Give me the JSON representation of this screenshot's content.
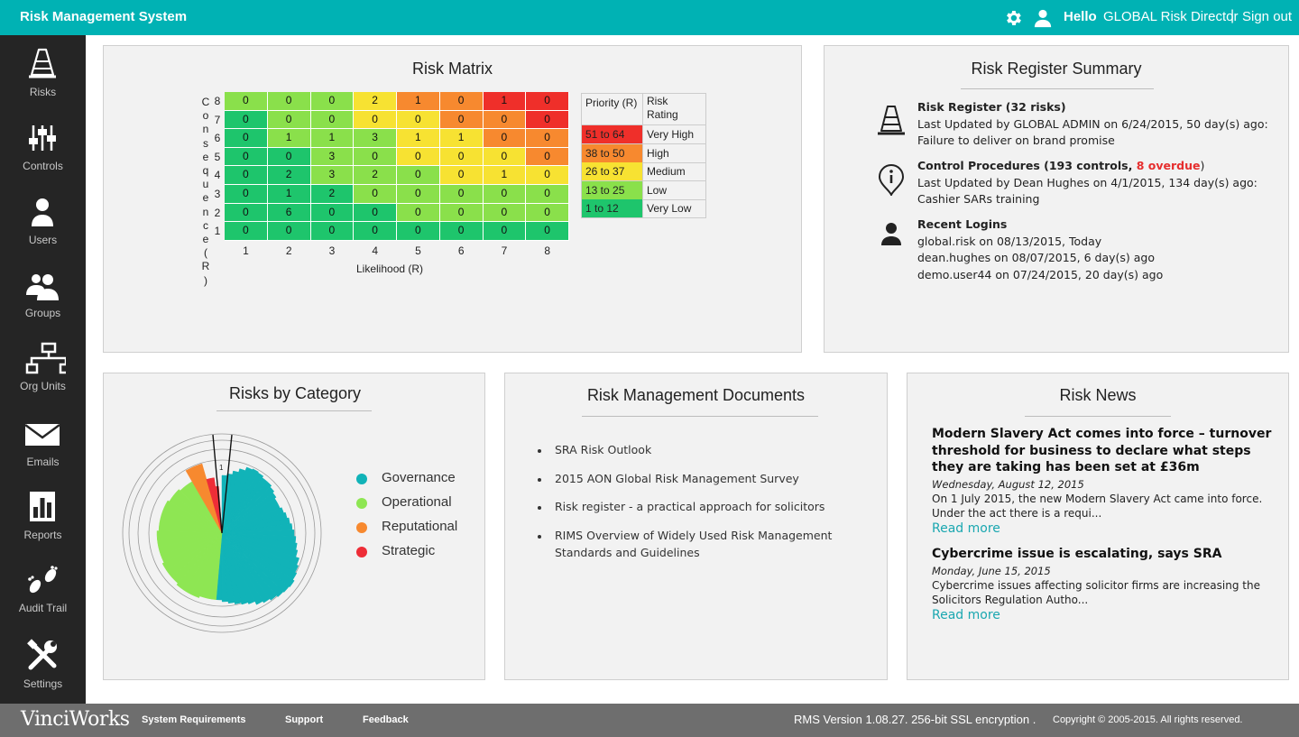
{
  "header": {
    "title": "Risk Management System",
    "hello": "Hello",
    "user_role": "GLOBAL Risk Director",
    "separator": "|",
    "sign_out": "Sign out",
    "icons": [
      "gear-icon",
      "user-icon"
    ]
  },
  "sidebar": {
    "items": [
      {
        "label": "Risks",
        "icon": "traffic-cone-icon"
      },
      {
        "label": "Controls",
        "icon": "sliders-icon"
      },
      {
        "label": "Users",
        "icon": "user-icon"
      },
      {
        "label": "Groups",
        "icon": "group-icon"
      },
      {
        "label": "Org Units",
        "icon": "org-chart-icon"
      },
      {
        "label": "Emails",
        "icon": "envelope-icon"
      },
      {
        "label": "Reports",
        "icon": "bar-chart-icon"
      },
      {
        "label": "Audit Trail",
        "icon": "footprints-icon"
      },
      {
        "label": "Settings",
        "icon": "tools-icon"
      }
    ]
  },
  "risk_matrix": {
    "title": "Risk Matrix",
    "y_axis_label": "Consequence(R)",
    "x_axis_label": "Likelihood (R)",
    "x_ticks": [
      "1",
      "2",
      "3",
      "4",
      "5",
      "6",
      "7",
      "8"
    ],
    "y_ticks": [
      "8",
      "7",
      "6",
      "5",
      "4",
      "3",
      "2",
      "1"
    ],
    "rows": [
      [
        "0",
        "0",
        "0",
        "2",
        "1",
        "0",
        "1",
        "0"
      ],
      [
        "0",
        "0",
        "0",
        "0",
        "0",
        "0",
        "0",
        "0"
      ],
      [
        "0",
        "1",
        "1",
        "3",
        "1",
        "1",
        "0",
        "0"
      ],
      [
        "0",
        "0",
        "3",
        "0",
        "0",
        "0",
        "0",
        "0"
      ],
      [
        "0",
        "2",
        "3",
        "2",
        "0",
        "0",
        "1",
        "0"
      ],
      [
        "0",
        "1",
        "2",
        "0",
        "0",
        "0",
        "0",
        "0"
      ],
      [
        "0",
        "6",
        "0",
        "0",
        "0",
        "0",
        "0",
        "0"
      ],
      [
        "0",
        "0",
        "0",
        "0",
        "0",
        "0",
        "0",
        "0"
      ]
    ],
    "legend": {
      "header_priority": "Priority (R)",
      "header_rating": "Risk Rating",
      "rows": [
        {
          "range": "51 to 64",
          "rating": "Very High",
          "color": "#ef2f2a"
        },
        {
          "range": "38 to 50",
          "rating": "High",
          "color": "#f7892f"
        },
        {
          "range": "26 to 37",
          "rating": "Medium",
          "color": "#f7e232"
        },
        {
          "range": "13 to 25",
          "rating": "Low",
          "color": "#8ae04b"
        },
        {
          "range": "1 to 12",
          "rating": "Very Low",
          "color": "#1ec56c"
        }
      ]
    }
  },
  "risk_register": {
    "title": "Risk Register Summary",
    "register": {
      "heading": "Risk Register (32 risks)",
      "line1": "Last Updated by GLOBAL ADMIN on 6/24/2015, 50 day(s) ago:",
      "line2": "Failure to deliver on brand promise"
    },
    "controls": {
      "heading": "Control Procedures (193 controls, ",
      "overdue": "8 overdue",
      "heading_end": ")",
      "line1": "Last Updated by Dean Hughes on 4/1/2015, 134 day(s) ago:",
      "line2": "Cashier SARs training"
    },
    "logins": {
      "heading": "Recent Logins",
      "items": [
        "global.risk on 08/13/2015, Today",
        "dean.hughes on 08/07/2015, 6 day(s) ago",
        "demo.user44 on 07/24/2015, 20 day(s) ago"
      ]
    }
  },
  "risks_by_category": {
    "title": "Risks by Category",
    "legend": [
      {
        "label": "Governance",
        "color": "#11b3b8"
      },
      {
        "label": "Operational",
        "color": "#8ee653"
      },
      {
        "label": "Reputational",
        "color": "#f7892f"
      },
      {
        "label": "Strategic",
        "color": "#ee2d37"
      }
    ],
    "scale_label": "1"
  },
  "documents": {
    "title": "Risk Management Documents",
    "items": [
      "SRA Risk Outlook",
      "2015 AON Global Risk Management Survey",
      "Risk register - a practical approach for solicitors",
      "RIMS Overview of Widely Used Risk Management Standards and Guidelines"
    ]
  },
  "news": {
    "title": "Risk News",
    "items": [
      {
        "headline": "Modern Slavery Act comes into force – turnover threshold for business to declare what steps they are taking has been set at £36m",
        "date": "Wednesday, August 12, 2015",
        "summary": "On 1 July 2015, the new Modern Slavery Act came into force. Under the act there is a requi...",
        "more": "Read more"
      },
      {
        "headline": "Cybercrime issue is escalating, says SRA",
        "date": "Monday, June 15, 2015",
        "summary": "Cybercrime issues affecting solicitor firms are increasing the Solicitors Regulation Autho...",
        "more": "Read more"
      }
    ]
  },
  "footer": {
    "logo": "VinciWorks",
    "links": [
      "System Requirements",
      "Support",
      "Feedback"
    ],
    "version": "RMS Version 1.08.27.  256-bit SSL encryption .",
    "copyright": "Copyright © 2005-2015. All rights reserved."
  },
  "colors": {
    "accent": "#00b2b4",
    "sidebar": "#252525",
    "panel": "#f2f2f2",
    "footer": "#6e6e6e",
    "link": "#1aa7b0"
  }
}
